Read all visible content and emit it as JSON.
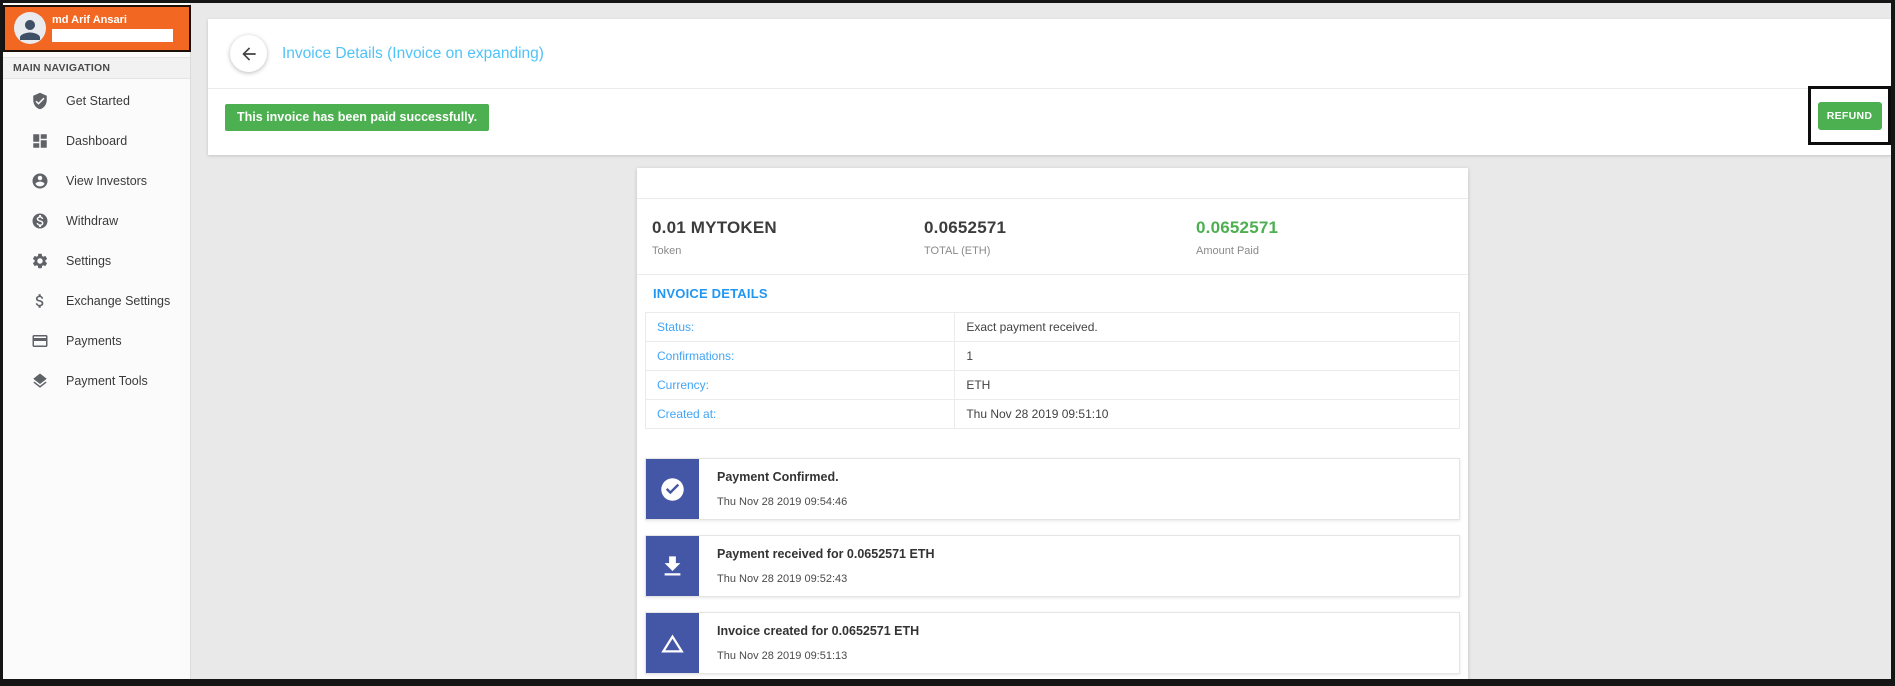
{
  "user": {
    "name": "md Arif Ansari"
  },
  "sidebar": {
    "section_label": "MAIN NAVIGATION",
    "items": [
      {
        "label": "Get Started",
        "icon": "shield-check-icon"
      },
      {
        "label": "Dashboard",
        "icon": "dashboard-icon"
      },
      {
        "label": "View Investors",
        "icon": "person-circle-icon"
      },
      {
        "label": "Withdraw",
        "icon": "dollar-circle-icon"
      },
      {
        "label": "Settings",
        "icon": "gear-icon"
      },
      {
        "label": "Exchange Settings",
        "icon": "dollar-icon"
      },
      {
        "label": "Payments",
        "icon": "credit-card-icon"
      },
      {
        "label": "Payment Tools",
        "icon": "layers-icon"
      }
    ]
  },
  "header": {
    "title": "Invoice Details (Invoice on expanding)"
  },
  "status_banner": {
    "text": "This invoice has been paid successfully."
  },
  "refund_button": {
    "label": "REFUND"
  },
  "invoice": {
    "stats": [
      {
        "value": "0.01 MYTOKEN",
        "label": "Token"
      },
      {
        "value": "0.0652571",
        "label": "TOTAL (ETH)"
      },
      {
        "value": "0.0652571",
        "label": "Amount Paid",
        "highlight": "green"
      }
    ],
    "details": {
      "heading": "INVOICE DETAILS",
      "rows": [
        {
          "label": "Status:",
          "value": "Exact payment received."
        },
        {
          "label": "Confirmations:",
          "value": "1"
        },
        {
          "label": "Currency:",
          "value": "ETH"
        },
        {
          "label": "Created at:",
          "value": "Thu Nov 28 2019 09:51:10"
        }
      ]
    },
    "timeline": [
      {
        "icon": "check-circle-icon",
        "title": "Payment Confirmed.",
        "date": "Thu Nov 28 2019 09:54:46"
      },
      {
        "icon": "download-icon",
        "title": "Payment received for 0.0652571 ETH",
        "date": "Thu Nov 28 2019 09:52:43"
      },
      {
        "icon": "triangle-icon",
        "title": "Invoice created for 0.0652571 ETH",
        "date": "Thu Nov 28 2019 09:51:13"
      }
    ]
  },
  "colors": {
    "accent_orange": "#F26722",
    "success_green": "#4CAF50",
    "link_blue": "#42A5F5",
    "heading_blue": "#2196F3",
    "title_light_blue": "#4FC3F7",
    "timeline_blue": "#4456A6"
  }
}
